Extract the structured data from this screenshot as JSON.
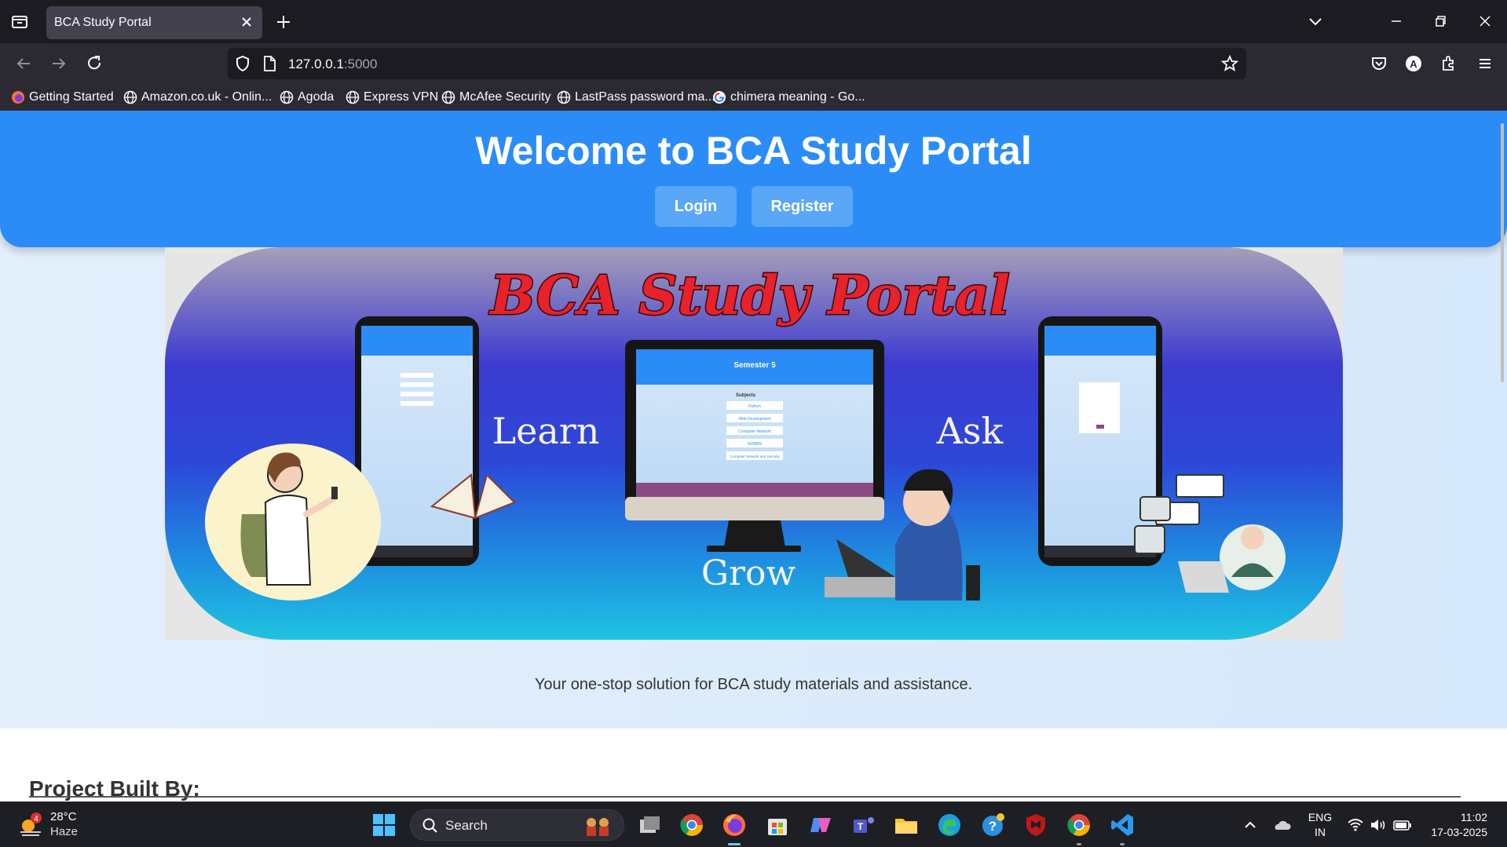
{
  "browser": {
    "tab_title": "BCA Study Portal",
    "url_host": "127.0.0.1",
    "url_port": ":5000",
    "bookmarks": [
      "Getting Started",
      "Amazon.co.uk - Onlin...",
      "Agoda",
      "Express VPN",
      "McAfee Security",
      "LastPass password ma...",
      "chimera meaning - Go..."
    ]
  },
  "header": {
    "title": "Welcome to BCA Study Portal",
    "login_label": "Login",
    "register_label": "Register"
  },
  "banner": {
    "title": "BCA Study Portal",
    "word_learn": "Learn",
    "word_ask": "Ask",
    "word_grow": "Grow",
    "screen_title": "Semester 5",
    "screen_subtitle": "Subjects",
    "screen_subjects": [
      "Python",
      "Web Development",
      "Computer Network",
      "RDBMS",
      "Computer Network and Security"
    ]
  },
  "main": {
    "tagline": "Your one-stop solution for BCA study materials and assistance.",
    "built_by": "Project Built By:"
  },
  "taskbar": {
    "weather_temp": "28°C",
    "weather_desc": "Haze",
    "weather_badge": "4",
    "search_label": "Search",
    "lang_top": "ENG",
    "lang_bottom": "IN",
    "time": "11:02",
    "date": "17-03-2025"
  },
  "colors": {
    "header_blue": "#2b8cf7",
    "button_blue": "#5aa7f8",
    "banner_title_red": "#e8212b"
  }
}
